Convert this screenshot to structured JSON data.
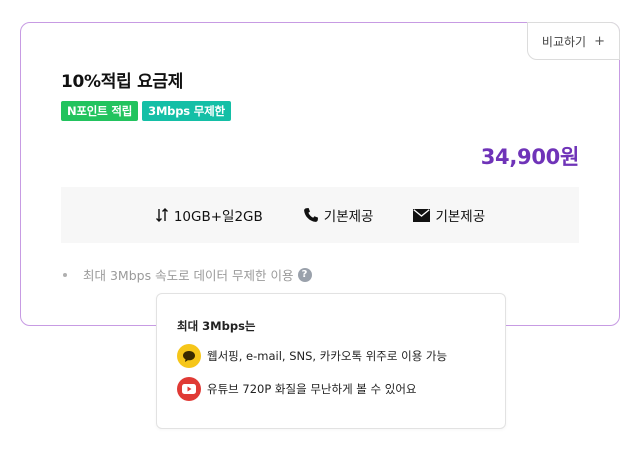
{
  "plan": {
    "compare_label": "비교하기",
    "compare_icon": "plus-icon",
    "title": "10%적립 요금제",
    "badges": [
      {
        "label": "N포인트 적립",
        "color": "#22c35e"
      },
      {
        "label": "3Mbps 무제한",
        "color": "#14bfa6"
      }
    ],
    "price": "34,900원",
    "price_color": "#6f33b8",
    "specs": [
      {
        "icon": "data-arrows-icon",
        "label": "10GB+일2GB"
      },
      {
        "icon": "phone-icon",
        "label": "기본제공"
      },
      {
        "icon": "envelope-icon",
        "label": "기본제공"
      }
    ],
    "note": "최대 3Mbps 속도로 데이터 무제한 이용",
    "note_icon": "question-circle-icon"
  },
  "tooltip": {
    "title": "최대 3Mbps는",
    "items": [
      {
        "icon": "chat-bubble-icon",
        "color": "#f6c619",
        "label": "웹서핑, e-mail, SNS, 카카오톡 위주로 이용 가능"
      },
      {
        "icon": "youtube-play-icon",
        "color": "#e03a35",
        "label": "유튜브 720P 화질을 무난하게 볼 수 있어요"
      }
    ]
  }
}
